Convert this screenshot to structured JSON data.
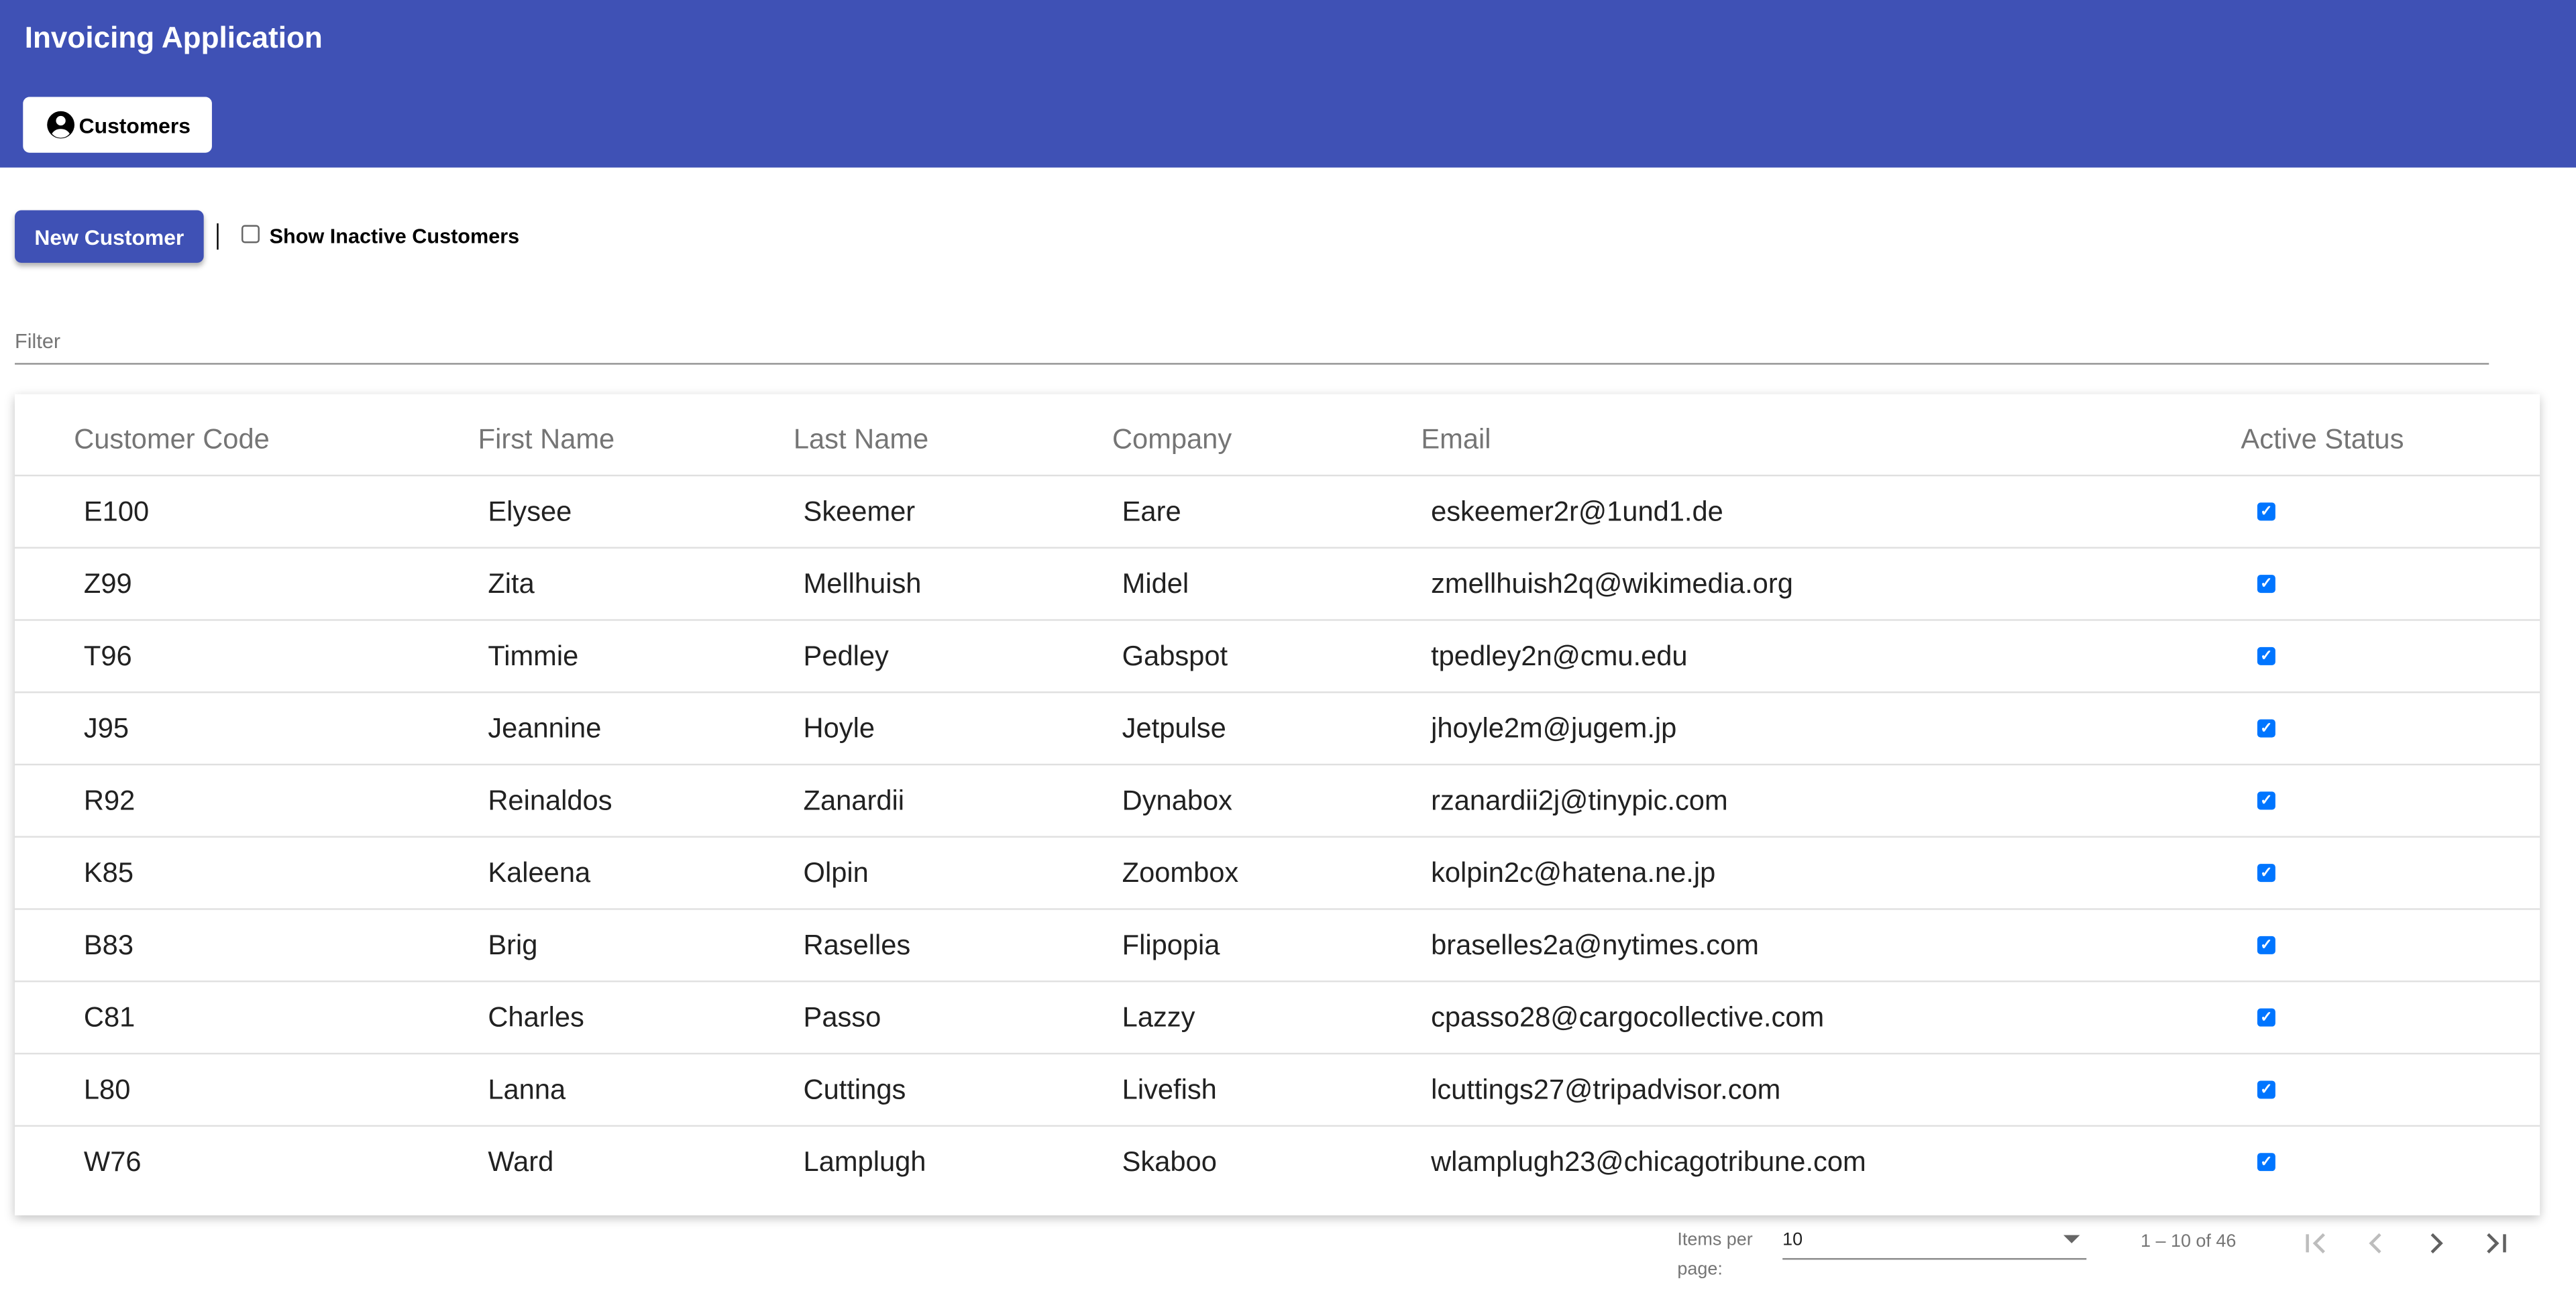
{
  "header": {
    "title": "Invoicing Application",
    "nav_customers": "Customers"
  },
  "toolbar": {
    "new_customer": "New Customer",
    "show_inactive": "Show Inactive Customers",
    "show_inactive_checked": false
  },
  "filter": {
    "label": "Filter",
    "value": ""
  },
  "table": {
    "columns": [
      "Customer Code",
      "First Name",
      "Last Name",
      "Company",
      "Email",
      "Active Status"
    ],
    "rows": [
      {
        "code": "E100",
        "first": "Elysee",
        "last": "Skeemer",
        "company": "Eare",
        "email": "eskeemer2r@1und1.de",
        "active": true
      },
      {
        "code": "Z99",
        "first": "Zita",
        "last": "Mellhuish",
        "company": "Midel",
        "email": "zmellhuish2q@wikimedia.org",
        "active": true
      },
      {
        "code": "T96",
        "first": "Timmie",
        "last": "Pedley",
        "company": "Gabspot",
        "email": "tpedley2n@cmu.edu",
        "active": true
      },
      {
        "code": "J95",
        "first": "Jeannine",
        "last": "Hoyle",
        "company": "Jetpulse",
        "email": "jhoyle2m@jugem.jp",
        "active": true
      },
      {
        "code": "R92",
        "first": "Reinaldos",
        "last": "Zanardii",
        "company": "Dynabox",
        "email": "rzanardii2j@tinypic.com",
        "active": true
      },
      {
        "code": "K85",
        "first": "Kaleena",
        "last": "Olpin",
        "company": "Zoombox",
        "email": "kolpin2c@hatena.ne.jp",
        "active": true
      },
      {
        "code": "B83",
        "first": "Brig",
        "last": "Raselles",
        "company": "Flipopia",
        "email": "braselles2a@nytimes.com",
        "active": true
      },
      {
        "code": "C81",
        "first": "Charles",
        "last": "Passo",
        "company": "Lazzy",
        "email": "cpasso28@cargocollective.com",
        "active": true
      },
      {
        "code": "L80",
        "first": "Lanna",
        "last": "Cuttings",
        "company": "Livefish",
        "email": "lcuttings27@tripadvisor.com",
        "active": true
      },
      {
        "code": "W76",
        "first": "Ward",
        "last": "Lamplugh",
        "company": "Skaboo",
        "email": "wlamplugh23@chicagotribune.com",
        "active": true
      }
    ]
  },
  "paginator": {
    "items_per_label_1": "Items per",
    "items_per_label_2": "page:",
    "page_size": "10",
    "range": "1 – 10 of 46"
  },
  "colors": {
    "primary": "#3f51b5",
    "checkbox": "#0075ff"
  }
}
